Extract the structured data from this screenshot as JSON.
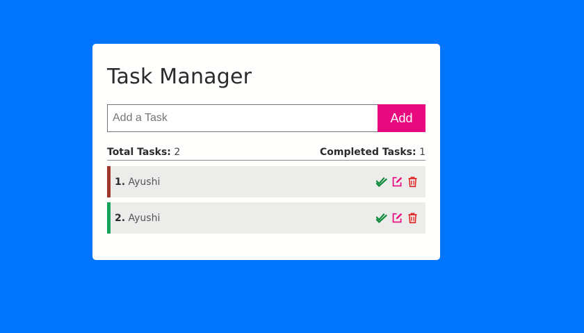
{
  "app": {
    "title": "Task Manager"
  },
  "input": {
    "placeholder": "Add a Task",
    "value": ""
  },
  "add_button": {
    "label": "Add"
  },
  "stats": {
    "total_label": "Total Tasks:",
    "total_value": "2",
    "completed_label": "Completed Tasks:",
    "completed_value": "1"
  },
  "tasks": [
    {
      "index": "1.",
      "text": "Ayushi",
      "status_color": "#a1372b"
    },
    {
      "index": "2.",
      "text": "Ayushi",
      "status_color": "#17a45a"
    }
  ],
  "icons": {
    "complete": "double-check-icon",
    "edit": "edit-icon",
    "delete": "trash-icon"
  },
  "colors": {
    "background": "#0275fe",
    "accent": "#e8097f",
    "complete_icon": "#0a8a3a",
    "edit_icon": "#e8097f",
    "delete_icon": "#e02020"
  }
}
